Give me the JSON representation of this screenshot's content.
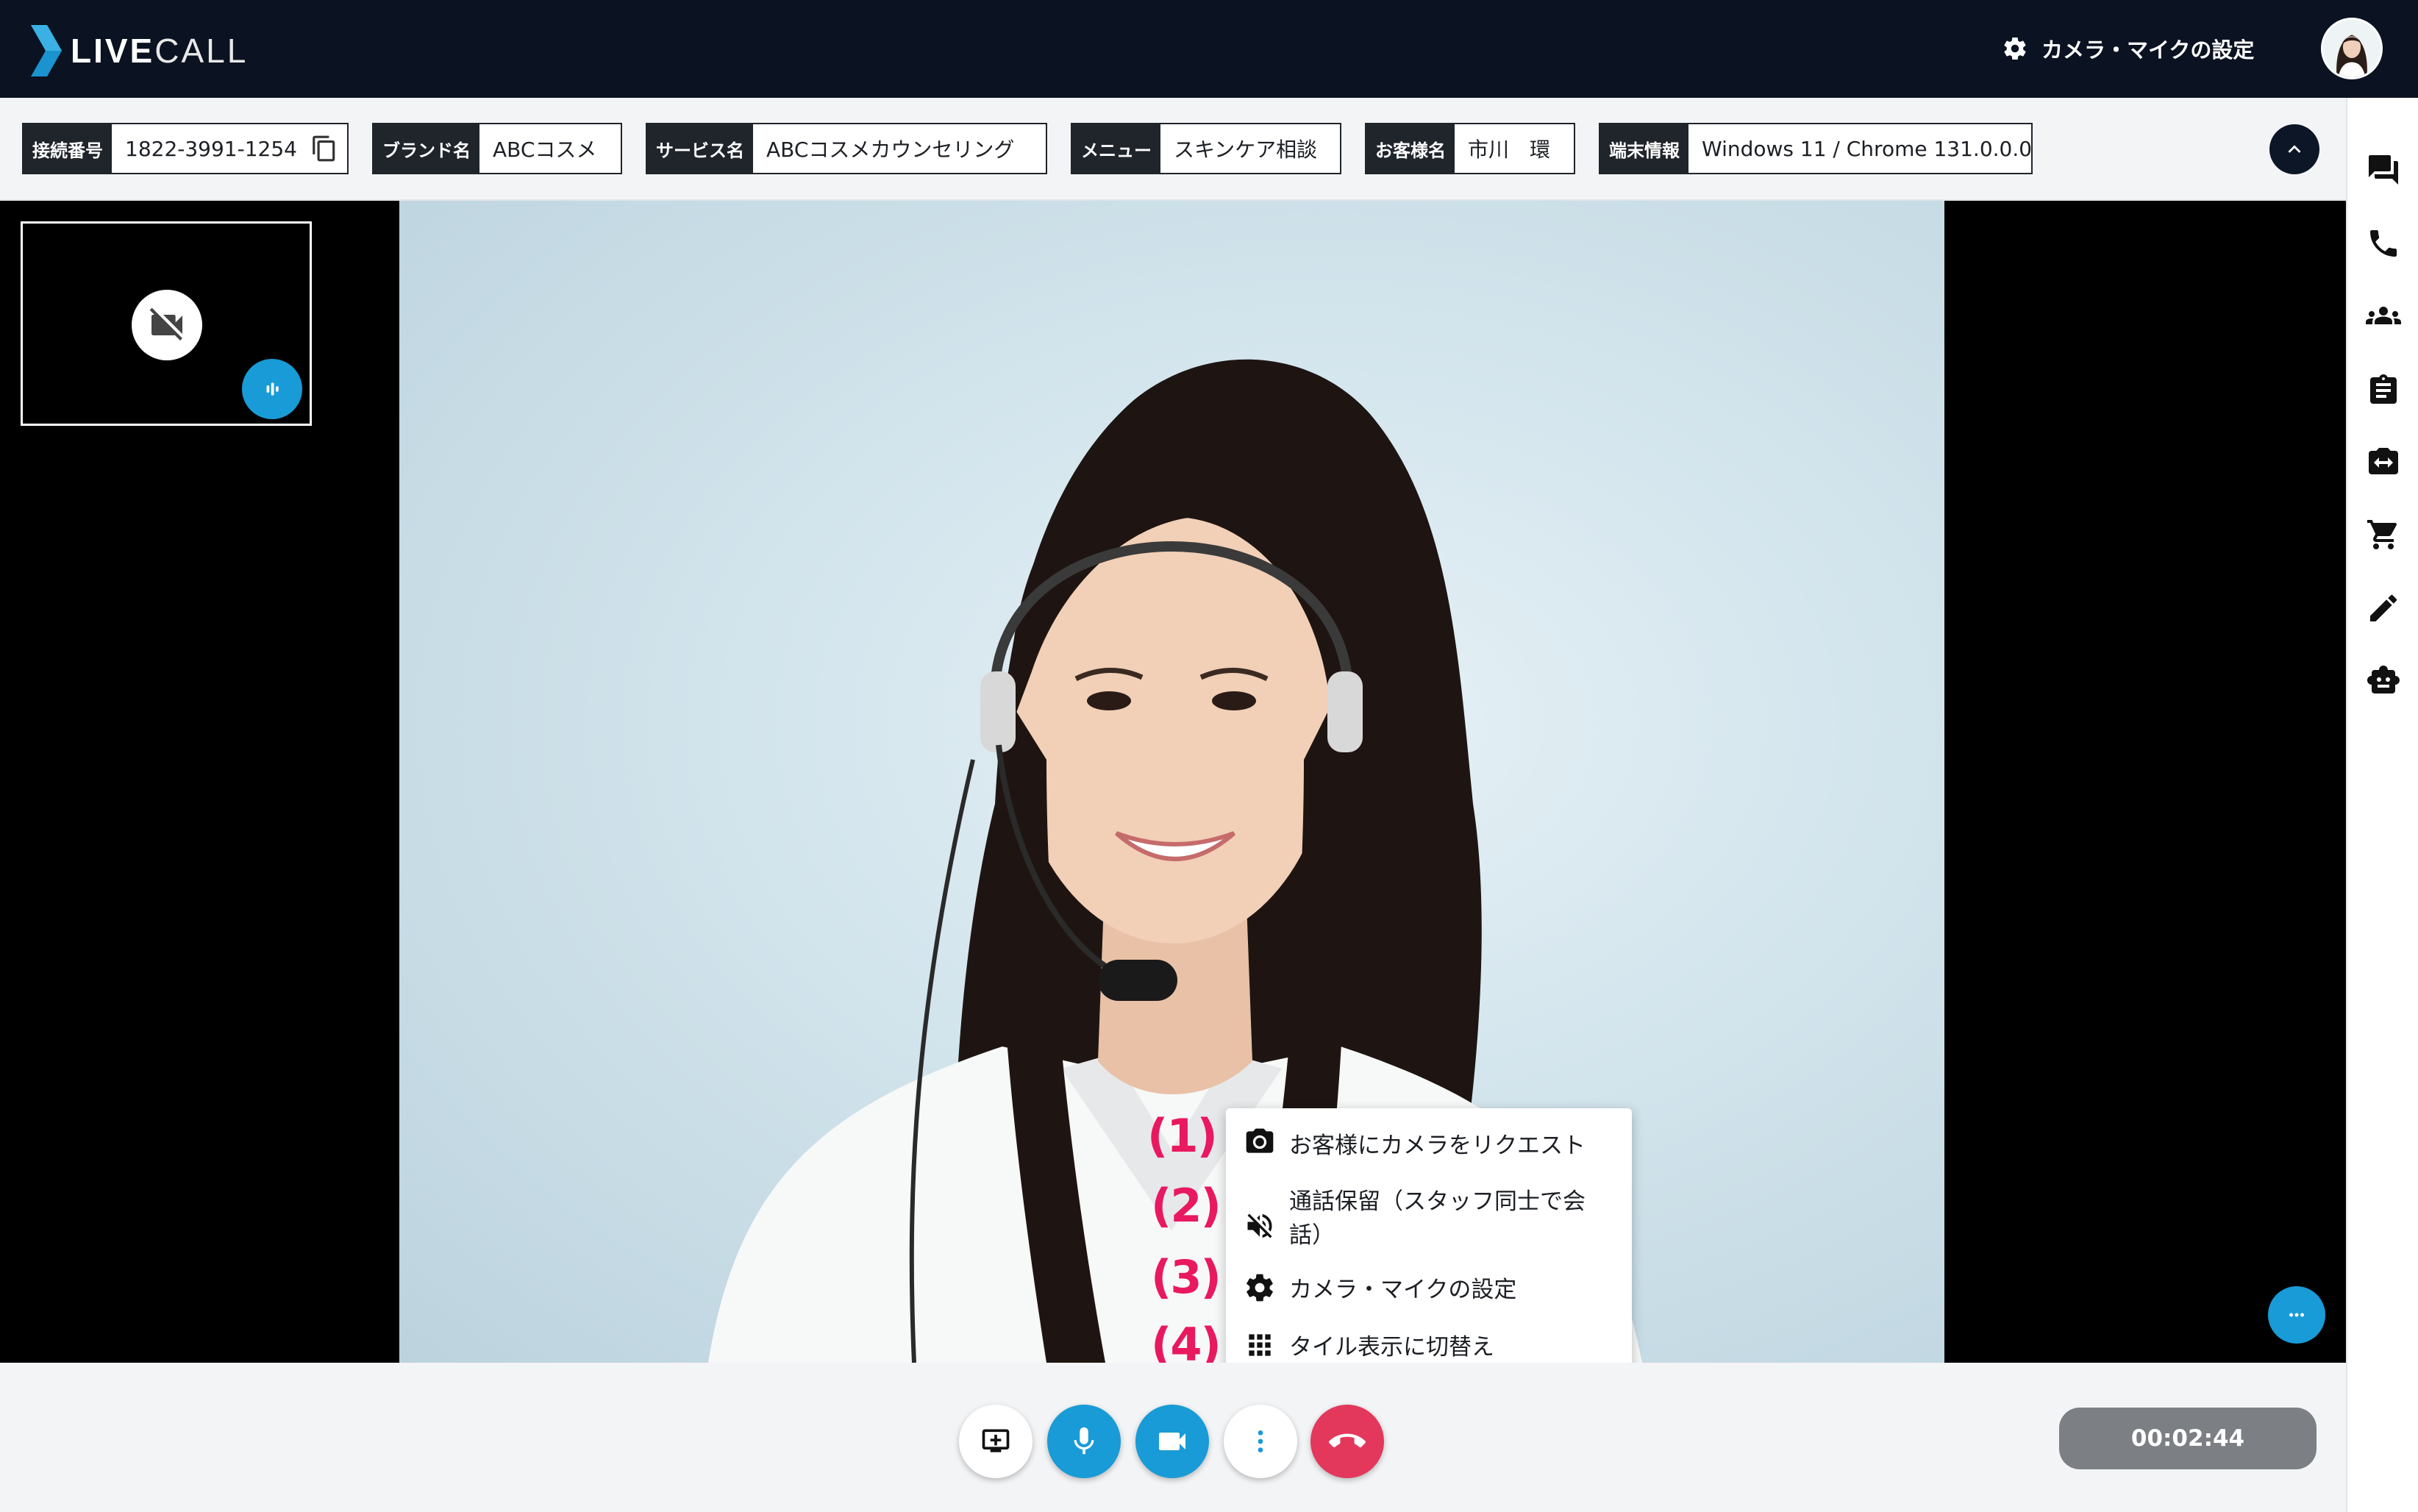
{
  "app": {
    "logo_text_bold": "LIVE",
    "logo_text_light": "CALL",
    "brand_color": "#1a93cf",
    "header_bg": "#0b1221"
  },
  "header": {
    "settings_label": "カメラ・マイクの設定",
    "settings_icon": "gear-icon",
    "avatar_icon": "user-avatar"
  },
  "info": {
    "connection": {
      "label": "接続番号",
      "value": "1822-3991-1254"
    },
    "brand": {
      "label": "ブランド名",
      "value": "ABCコスメ"
    },
    "service": {
      "label": "サービス名",
      "value": "ABCコスメカウンセリング"
    },
    "menu": {
      "label": "メニュー",
      "value": "スキンケア相談"
    },
    "customer": {
      "label": "お客様名",
      "value": "市川　環"
    },
    "device": {
      "label": "端末情報",
      "value": "Windows 11 / Chrome 131.0.0.0"
    }
  },
  "sidebar": {
    "icons": [
      "chat-icon",
      "phone-icon",
      "group-icon",
      "clipboard-icon",
      "camera-switch-icon",
      "cart-icon",
      "pencil-icon",
      "robot-icon"
    ]
  },
  "popup_menu": {
    "items": [
      {
        "marker": "(1)",
        "label": "お客様にカメラをリクエスト",
        "icon": "camera-icon"
      },
      {
        "marker": "(2)",
        "label": "通話保留（スタッフ同士で会話）",
        "icon": "volume-off-icon"
      },
      {
        "marker": "(3)",
        "label": "カメラ・マイクの設定",
        "icon": "gear-icon"
      },
      {
        "marker": "(4)",
        "label": "タイル表示に切替え",
        "icon": "grid-icon"
      }
    ],
    "marker_color": "#e8195f"
  },
  "controls": {
    "buttons": [
      "screen-share-icon",
      "microphone-icon",
      "video-camera-icon",
      "more-vertical-icon",
      "hang-up-icon"
    ],
    "accent": "#189bd6",
    "hangup_color": "#e3385c"
  },
  "timer": {
    "value": "00:02:44"
  }
}
